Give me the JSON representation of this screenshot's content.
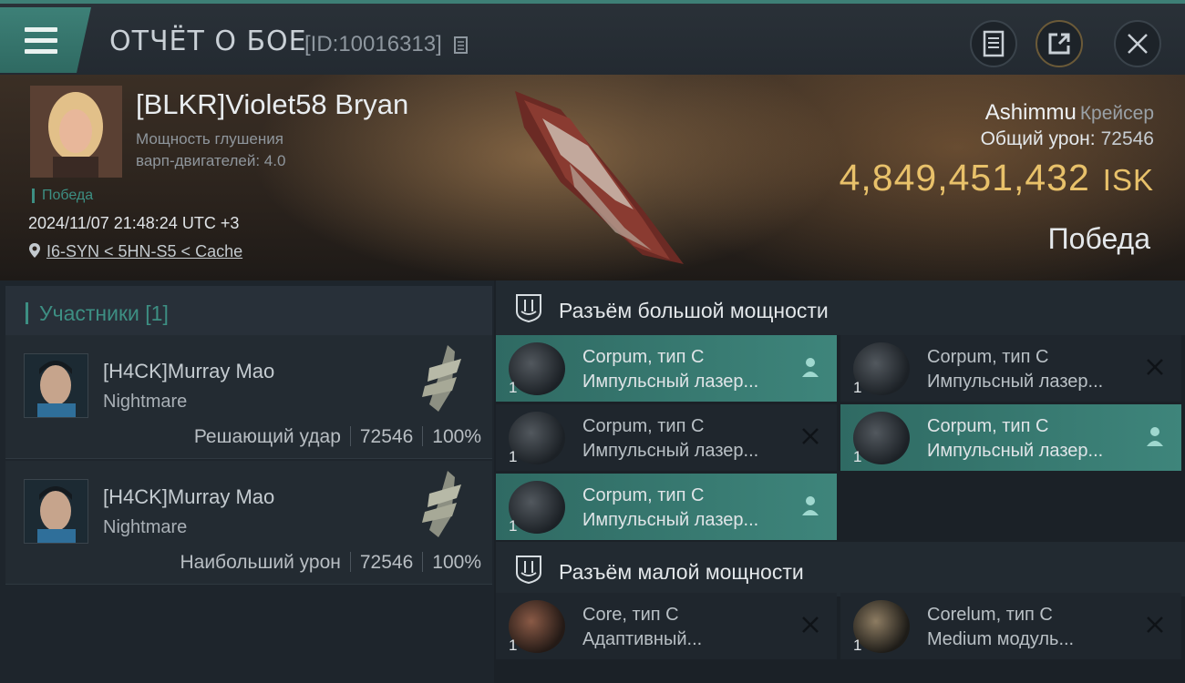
{
  "header": {
    "title": "ОТЧЁТ О БОЕ",
    "report_id": "[ID:10016313]",
    "icons": [
      "menu-icon",
      "copy-icon",
      "document-icon",
      "share-icon",
      "close-icon"
    ]
  },
  "victim": {
    "name": "[BLKR]Violet58 Bryan",
    "warp_label_1": "Мощность глушения",
    "warp_label_2": "варп-двигателей: 4.0",
    "result_tag": "Победа",
    "timestamp": "2024/11/07 21:48:24 UTC +3",
    "location": "I6-SYN < 5HN-S5 < Cache",
    "ship_name": "Ashimmu",
    "ship_class": "Крейсер",
    "damage_label": "Общий урон:",
    "damage_value": "72546",
    "isk_value": "4,849,451,432",
    "isk_currency": "ISK",
    "outcome": "Победа"
  },
  "participants": {
    "title": "Участники [1]",
    "rows": [
      {
        "name": "[H4CK]Murray Mao",
        "ship": "Nightmare",
        "role": "Решающий удар",
        "damage": "72546",
        "percent": "100%"
      },
      {
        "name": "[H4CK]Murray Mao",
        "ship": "Nightmare",
        "role": "Наибольший урон",
        "damage": "72546",
        "percent": "100%"
      }
    ]
  },
  "fitting": {
    "high_slot_title": "Разъём большой мощности",
    "low_slot_title": "Разъём малой мощности",
    "high_modules": [
      {
        "qty": "1",
        "line1": "Corpum, тип C",
        "line2": "Импульсный лазер...",
        "status": "dropped",
        "status_icon": "person-icon"
      },
      {
        "qty": "1",
        "line1": "Corpum, тип C",
        "line2": "Импульсный лазер...",
        "status": "destroyed",
        "status_icon": "x-icon"
      },
      {
        "qty": "1",
        "line1": "Corpum, тип C",
        "line2": "Импульсный лазер...",
        "status": "destroyed",
        "status_icon": "x-icon"
      },
      {
        "qty": "1",
        "line1": "Corpum, тип C",
        "line2": "Импульсный лазер...",
        "status": "dropped",
        "status_icon": "person-icon"
      },
      {
        "qty": "1",
        "line1": "Corpum, тип C",
        "line2": "Импульсный лазер...",
        "status": "dropped",
        "status_icon": "person-icon"
      }
    ],
    "low_modules": [
      {
        "qty": "1",
        "line1": "Core, тип C",
        "line2": "Адаптивный...",
        "status": "destroyed",
        "status_icon": "x-icon"
      },
      {
        "qty": "1",
        "line1": "Corelum, тип C",
        "line2": "Medium модуль...",
        "status": "destroyed",
        "status_icon": "x-icon"
      }
    ]
  },
  "colors": {
    "accent_teal": "#3d8f83",
    "isk_gold": "#e8c16a",
    "panel_dark": "#1b2127"
  }
}
